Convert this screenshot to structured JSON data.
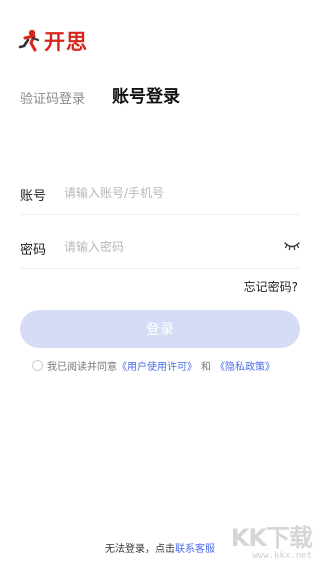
{
  "brand": {
    "name": "开思",
    "logo_icon": "runner-logo-icon",
    "accent": "#d9261c"
  },
  "tabs": {
    "sms_login": "验证码登录",
    "account_login": "账号登录"
  },
  "account": {
    "label": "账号",
    "placeholder": "请输入账号/手机号"
  },
  "password": {
    "label": "密码",
    "placeholder": "请输入密码",
    "toggle_icon": "eye-closed-icon"
  },
  "forgot": "忘记密码?",
  "login_button": "登录",
  "agreement": {
    "prefix": "我已阅读并同意",
    "user_license": "《用户使用许可》",
    "and": "和",
    "privacy": "《隐私政策》"
  },
  "footer": {
    "text": "无法登录，点击",
    "link": "联系客服"
  },
  "watermark": {
    "title": "KK下载",
    "url": "www.kkx.net"
  }
}
